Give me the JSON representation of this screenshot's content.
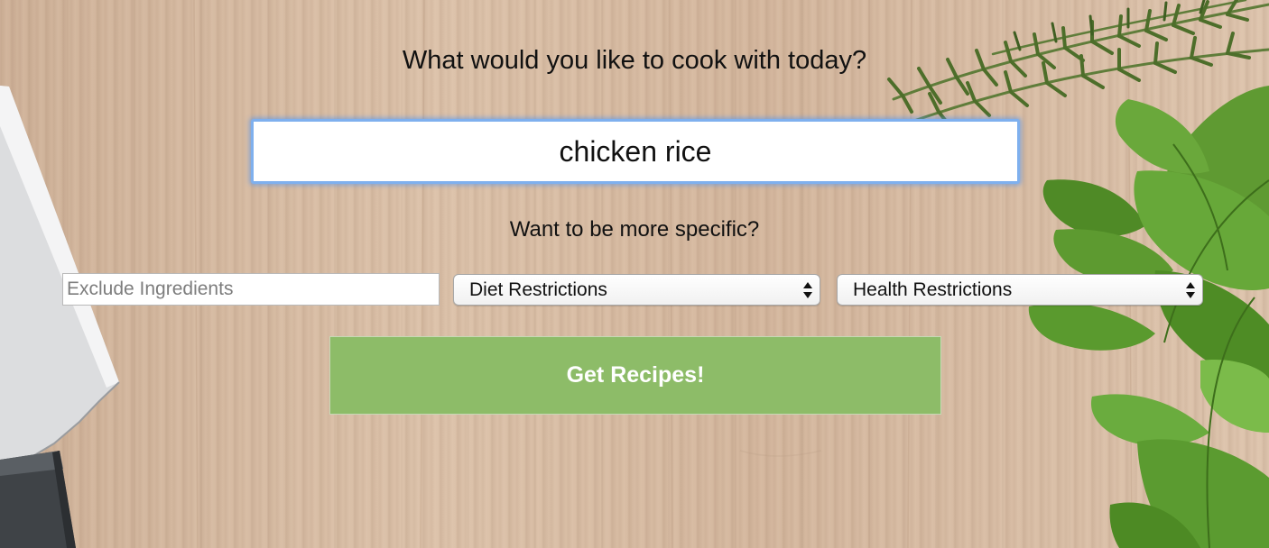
{
  "search": {
    "heading": "What would you like to cook with today?",
    "value": "chicken rice"
  },
  "filters": {
    "heading": "Want to be more specific?",
    "exclude_placeholder": "Exclude Ingredients",
    "diet_selected": "Diet Restrictions",
    "health_selected": "Health Restrictions"
  },
  "actions": {
    "submit_label": "Get Recipes!"
  },
  "colors": {
    "button_green": "#8dbc68",
    "focus_ring": "#7fb0ee",
    "wood": "#d7bba3"
  },
  "icons": {
    "background_left": "chef-knife-icon",
    "background_right": "herbs-icon",
    "select_arrows": "up-down-arrows-icon"
  }
}
